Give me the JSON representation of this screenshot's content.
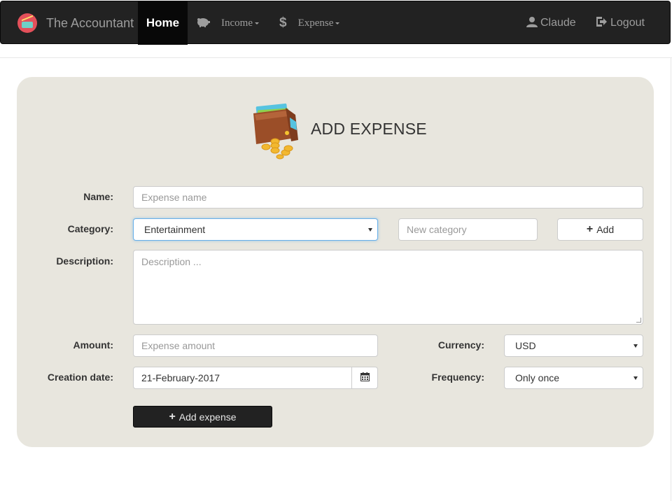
{
  "navbar": {
    "brand": "The Accountant",
    "home": "Home",
    "income": "Income",
    "expense": "Expense",
    "user": "Claude",
    "logout": "Logout"
  },
  "form": {
    "title": "ADD EXPENSE",
    "name_label": "Name:",
    "name_placeholder": "Expense name",
    "category_label": "Category:",
    "category_value": "Entertainment",
    "new_category_placeholder": "New category",
    "add_category_label": "Add",
    "description_label": "Description:",
    "description_placeholder": "Description ...",
    "amount_label": "Amount:",
    "amount_placeholder": "Expense amount",
    "currency_label": "Currency:",
    "currency_value": "USD",
    "date_label": "Creation date:",
    "date_value": "21-February-2017",
    "frequency_label": "Frequency:",
    "frequency_value": "Only once",
    "submit_label": "Add expense"
  },
  "colors": {
    "navbar": "#222222",
    "panel": "#e8e6de",
    "focus": "#66afe9",
    "brand_logo": "#e4505a"
  },
  "icons": [
    "app-logo-icon",
    "piggy-bank-icon",
    "dollar-icon",
    "user-icon",
    "logout-icon",
    "wallet-icon",
    "plus-icon",
    "calendar-icon"
  ]
}
